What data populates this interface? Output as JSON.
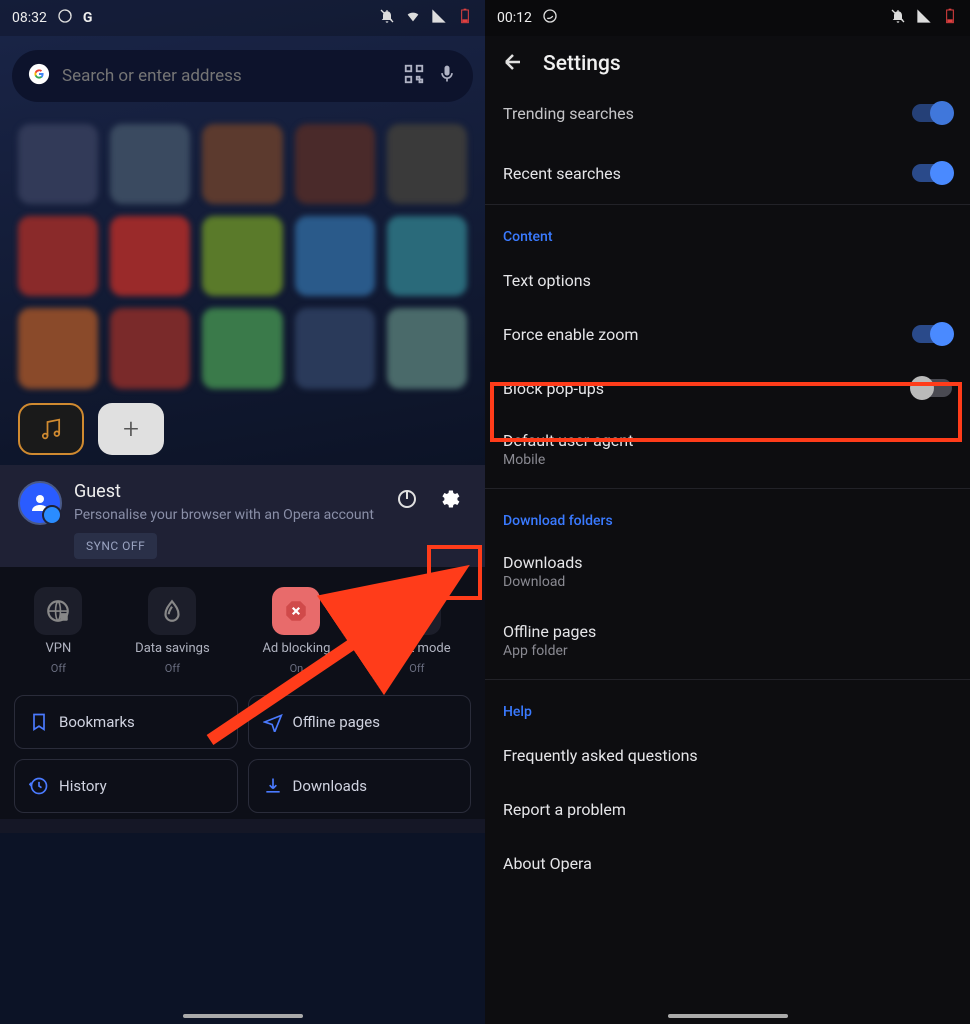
{
  "left": {
    "status": {
      "time": "08:32",
      "battery_low": true
    },
    "search_placeholder": "Search or enter address",
    "dock": {
      "add": "+"
    },
    "profile": {
      "name": "Guest",
      "sub": "Personalise your browser with an Opera account",
      "sync_off": "SYNC OFF"
    },
    "quick": [
      {
        "label": "VPN",
        "state": "Off"
      },
      {
        "label": "Data savings",
        "state": "Off"
      },
      {
        "label": "Ad blocking",
        "state": "On"
      },
      {
        "label": "Night mode",
        "state": "Off"
      }
    ],
    "links": [
      {
        "label": "Bookmarks"
      },
      {
        "label": "Offline pages"
      },
      {
        "label": "History"
      },
      {
        "label": "Downloads"
      }
    ]
  },
  "right": {
    "status": {
      "time": "00:12",
      "battery_low": true
    },
    "title": "Settings",
    "partial_top": "Trending searches",
    "items": [
      {
        "label": "Recent searches",
        "toggle": "on"
      }
    ],
    "section_content": "Content",
    "content_items": [
      {
        "label": "Text options",
        "toggle": null
      },
      {
        "label": "Force enable zoom",
        "toggle": "on"
      },
      {
        "label": "Block pop-ups",
        "toggle": "off"
      },
      {
        "label": "Default user agent",
        "sub": "Mobile",
        "toggle": null
      }
    ],
    "section_download": "Download folders",
    "download_items": [
      {
        "label": "Downloads",
        "sub": "Download"
      },
      {
        "label": "Offline pages",
        "sub": "App folder"
      }
    ],
    "section_help": "Help",
    "help_items": [
      {
        "label": "Frequently asked questions"
      },
      {
        "label": "Report a problem"
      },
      {
        "label": "About Opera"
      }
    ]
  }
}
